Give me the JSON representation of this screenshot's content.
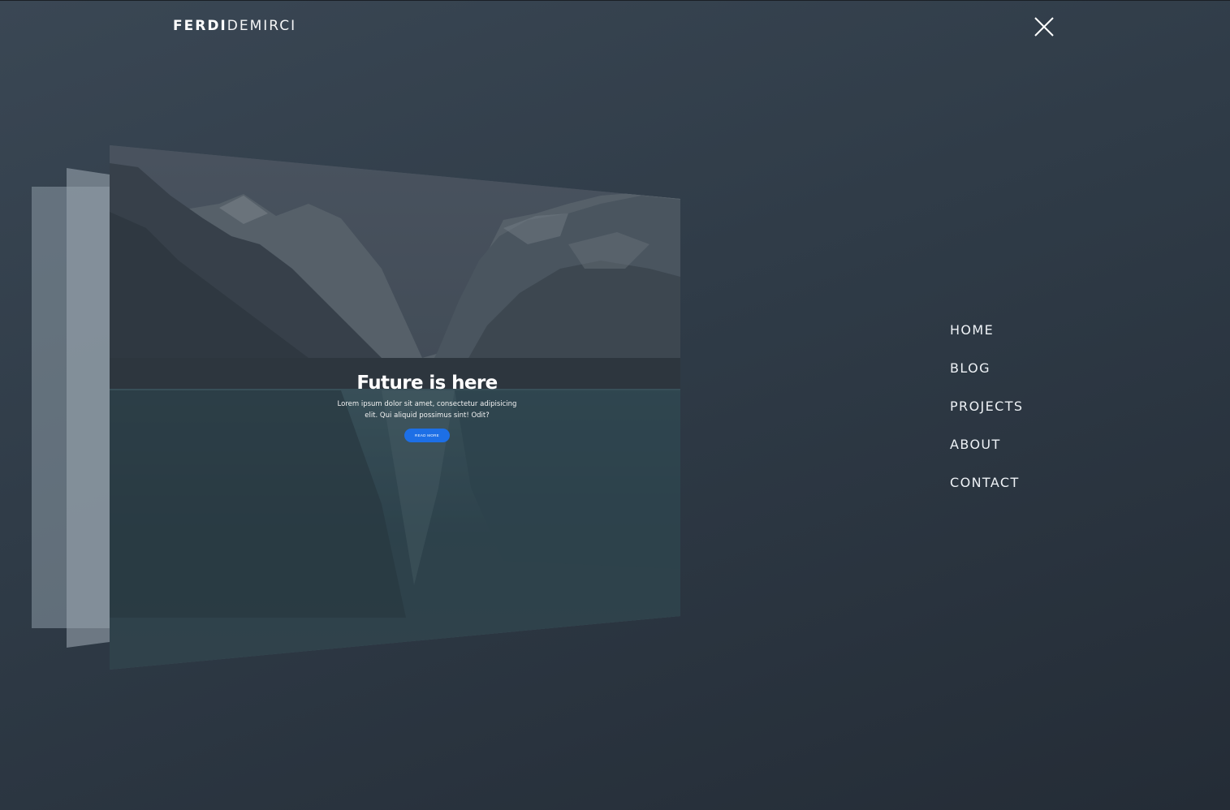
{
  "brand": {
    "bold": "FERDI",
    "light": "DEMIRCI"
  },
  "close": {
    "icon": "close-icon"
  },
  "nav": {
    "items": [
      {
        "label": "HOME"
      },
      {
        "label": "BLOG"
      },
      {
        "label": "PROJECTS"
      },
      {
        "label": "ABOUT"
      },
      {
        "label": "CONTACT"
      }
    ]
  },
  "slide": {
    "title": "Future is here",
    "description": "Lorem ipsum dolor sit amet, consectetur adipisicing elit. Qui aliquid possimus sint! Odit?",
    "button_label": "READ MORE",
    "image": "mountain-lake-landscape"
  },
  "colors": {
    "accent": "#1d6fe6",
    "background": "#2f3b47",
    "text": "#ffffff"
  }
}
